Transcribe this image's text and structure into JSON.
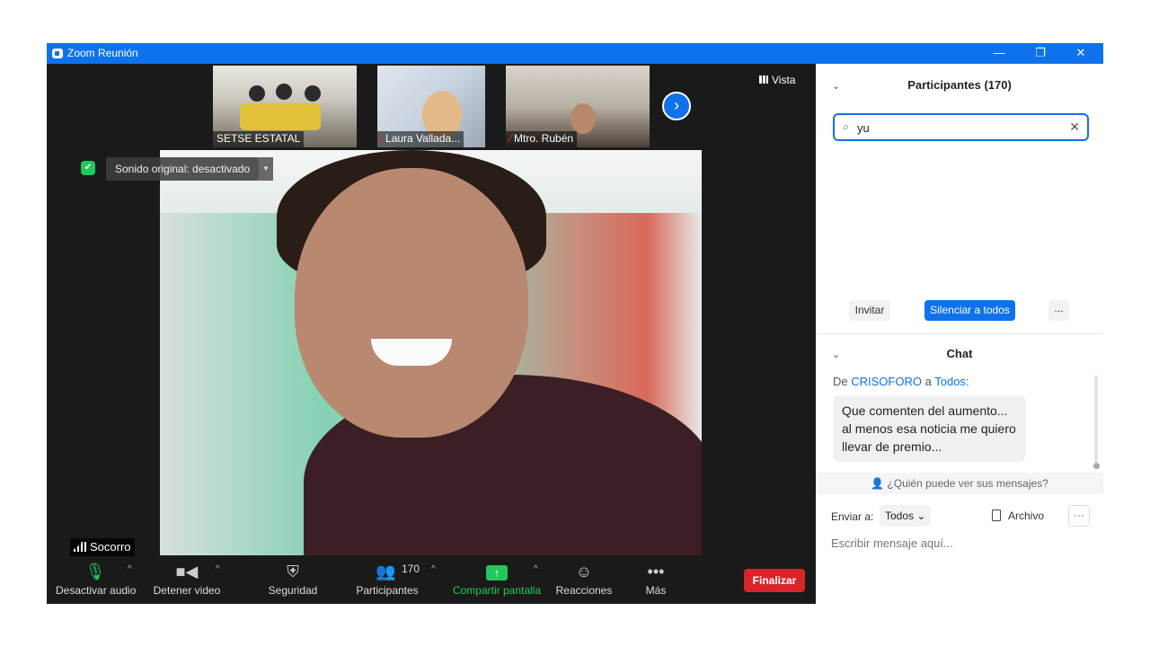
{
  "window": {
    "title": "Zoom Reunión",
    "minimize": "—",
    "restore": "❐",
    "close": "✕"
  },
  "thumbnails": [
    {
      "name": "SETSE ESTATAL",
      "muted": false
    },
    {
      "name": "Laura Vallada...",
      "muted": true
    },
    {
      "name": "Mtro. Rubén",
      "muted": true
    }
  ],
  "view_label": "Vista",
  "original_sound": "Sonido original: desactivado",
  "speaker_name": "Socorro",
  "toolbar": {
    "audio": "Desactivar audio",
    "video": "Detener video",
    "security": "Seguridad",
    "participants": "Participantes",
    "participants_count": "170",
    "share": "Compartir pantalla",
    "reactions": "Reacciones",
    "more": "Más",
    "end": "Finalizar"
  },
  "participants_panel": {
    "title": "Participantes (170)",
    "search_value": "yu",
    "invite": "Invitar",
    "mute_all": "Silenciar a todos",
    "more": "..."
  },
  "chat": {
    "title": "Chat",
    "from_prefix": "De",
    "sender": "CRISOFORO",
    "connector": "a",
    "recipient": "Todos",
    "colon": ":",
    "message": "Que comenten del aumento... al menos esa noticia me quiero llevar de premio...",
    "visibility": "¿Quién puede ver sus mensajes?",
    "send_to_label": "Enviar a:",
    "send_to_value": "Todos",
    "file": "Archivo",
    "placeholder": "Escribir mensaje aquí..."
  },
  "colors": {
    "zoom_blue": "#0e72ed",
    "share_green": "#23c85a",
    "end_red": "#d9252a"
  }
}
